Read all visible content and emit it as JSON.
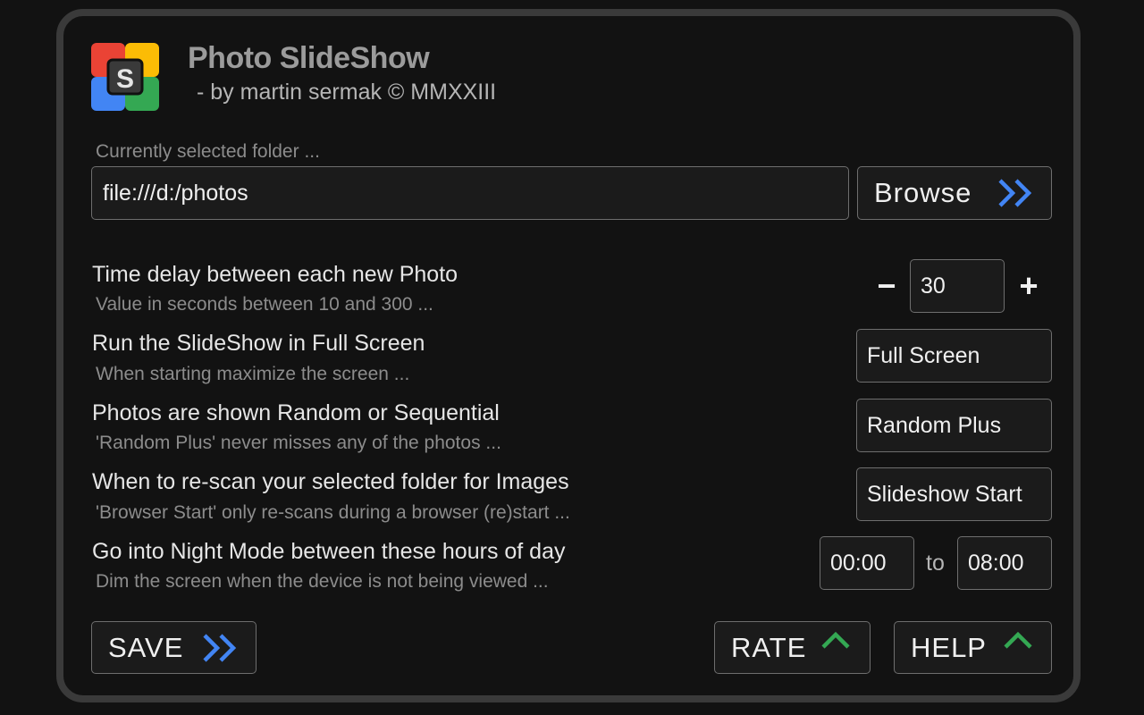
{
  "app": {
    "title": "Photo SlideShow",
    "subtitle": "- by martin sermak © MMXXIII",
    "logo_letter": "S",
    "logo_colors": [
      "#ea4335",
      "#fbbc05",
      "#4285f4",
      "#34a853"
    ]
  },
  "folder": {
    "label": "Currently selected folder ...",
    "value": "file:///d:/photos",
    "browse_label": "Browse"
  },
  "settings": {
    "delay": {
      "title": "Time delay between each new Photo",
      "subtitle": "Value in seconds between 10 and 300 ...",
      "minus": "−",
      "plus": "+",
      "value": "30"
    },
    "fullscreen": {
      "title": "Run the SlideShow in Full Screen",
      "subtitle": "When starting maximize the screen ...",
      "value": "Full Screen"
    },
    "order": {
      "title": "Photos are shown Random or Sequential",
      "subtitle": "'Random Plus' never misses any of the photos ...",
      "value": "Random Plus"
    },
    "rescan": {
      "title": "When to re-scan your selected folder for Images",
      "subtitle": "'Browser Start' only re-scans during a browser (re)start ...",
      "value": "Slideshow Start"
    },
    "night": {
      "title": "Go into Night Mode between these hours of day",
      "subtitle": "Dim the screen when the device is not being viewed ...",
      "from": "00:00",
      "to_label": "to",
      "to": "08:00"
    }
  },
  "footer": {
    "save_label": "SAVE",
    "rate_label": "RATE",
    "help_label": "HELP"
  },
  "colors": {
    "chevron_blue": "#4285f4",
    "chevron_green": "#34a853"
  }
}
